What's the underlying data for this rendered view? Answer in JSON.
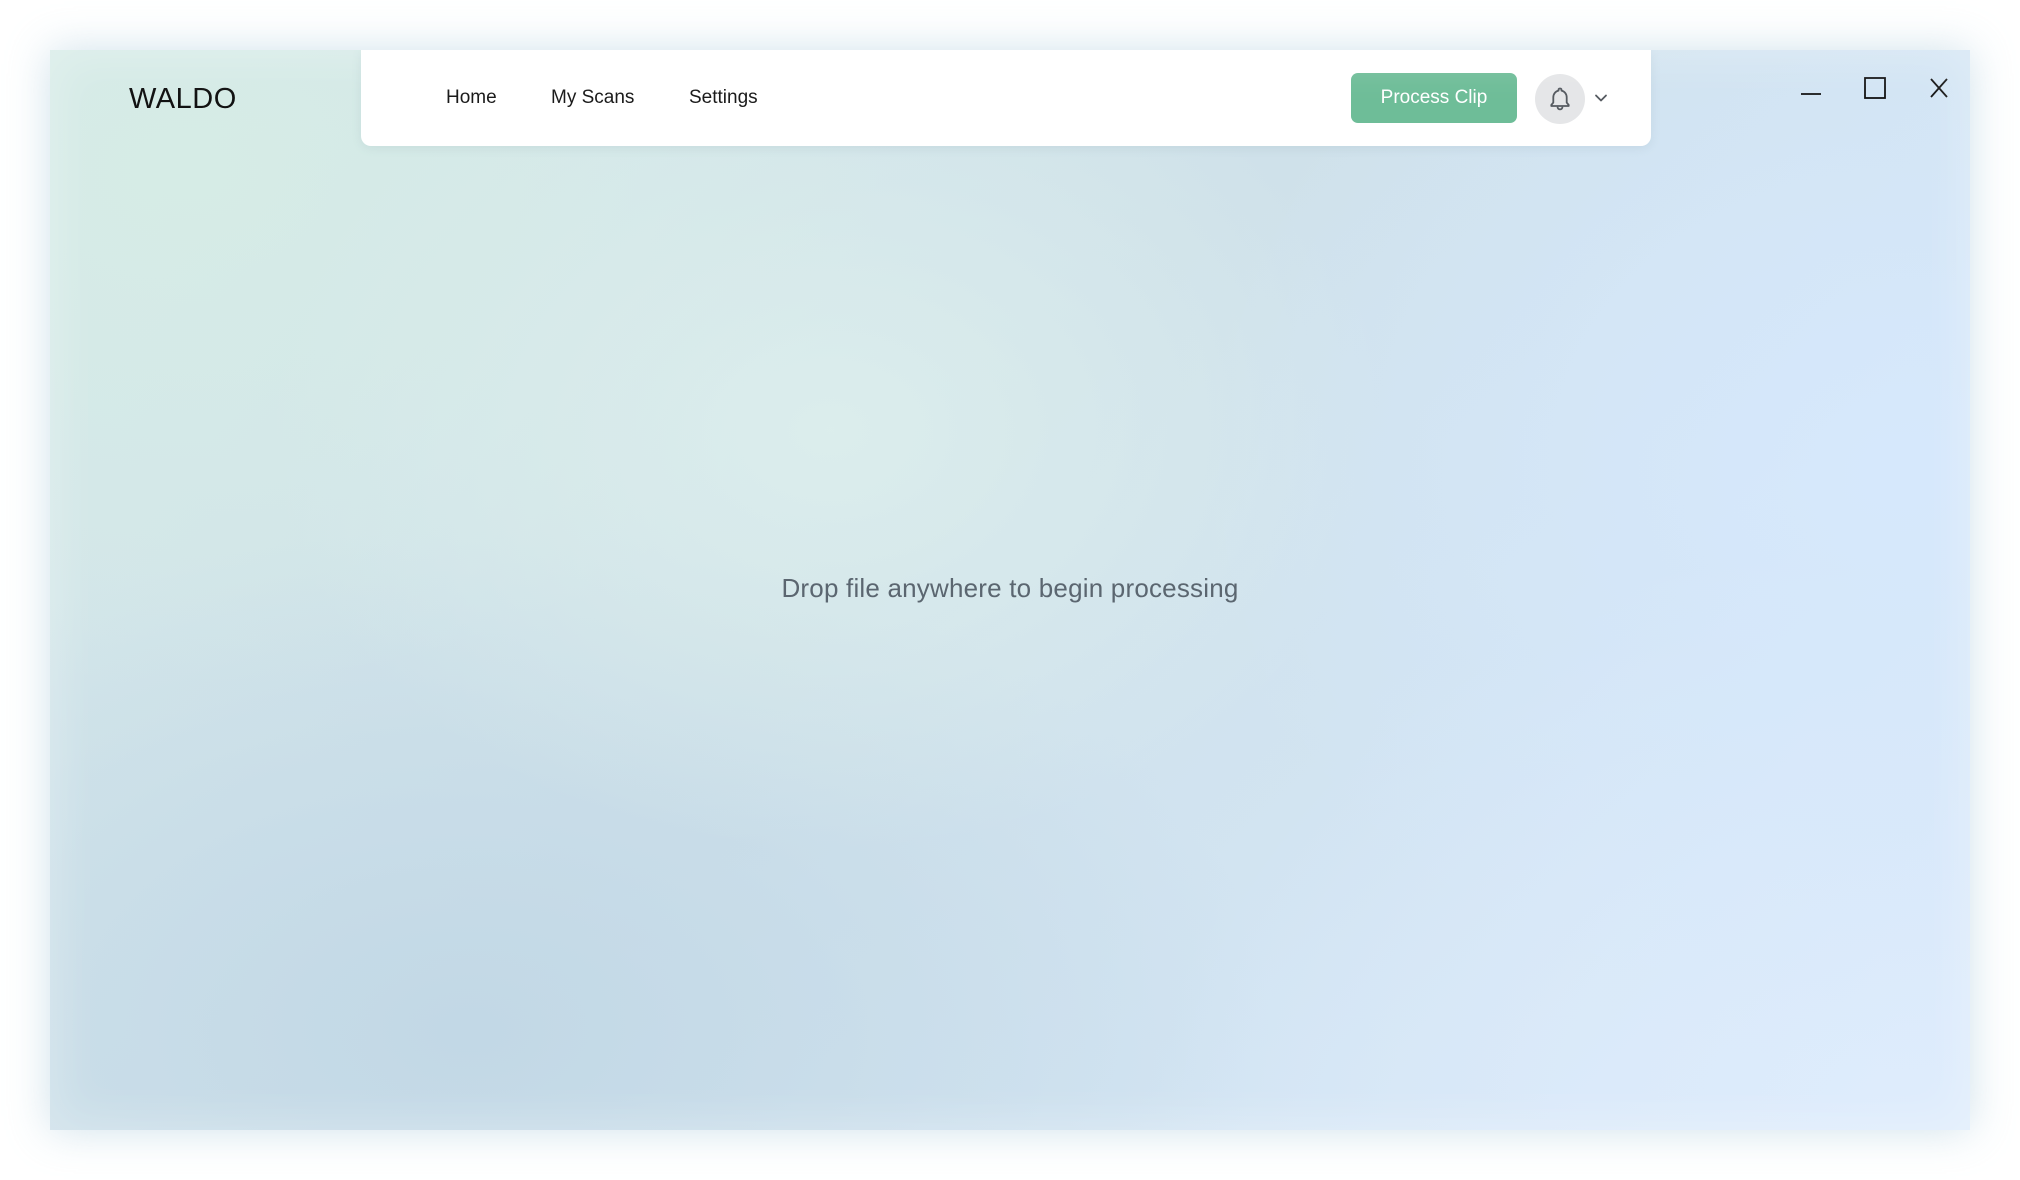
{
  "app": {
    "logo_text": "WALDO"
  },
  "nav": {
    "items": [
      {
        "label": "Home"
      },
      {
        "label": "My Scans"
      },
      {
        "label": "Settings"
      }
    ]
  },
  "actions": {
    "process_label": "Process Clip",
    "notifications_icon": "bell-icon",
    "dropdown_icon": "chevron-down-icon"
  },
  "window_controls": {
    "minimize_icon": "minimize-icon",
    "maximize_icon": "maximize-icon",
    "close_label": "X"
  },
  "main": {
    "drop_hint": "Drop file anywhere to begin processing"
  },
  "colors": {
    "accent": "#6ebd98",
    "text_primary": "#111111",
    "text_muted": "#5b6670"
  }
}
